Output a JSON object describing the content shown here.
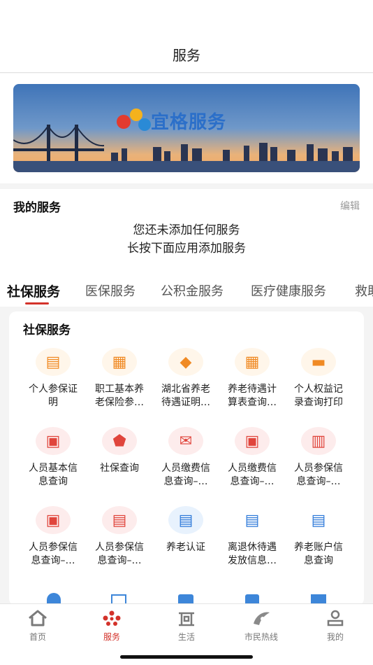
{
  "header": {
    "title": "服务"
  },
  "banner": {
    "logo_text": "宜格服务"
  },
  "my_services": {
    "title": "我的服务",
    "edit_label": "编辑",
    "empty_line1": "您还未添加任何服务",
    "empty_line2": "长按下面应用添加服务"
  },
  "tabs": [
    {
      "label": "社保服务",
      "active": true
    },
    {
      "label": "医保服务",
      "active": false
    },
    {
      "label": "公积金服务",
      "active": false
    },
    {
      "label": "医疗健康服务",
      "active": false
    },
    {
      "label": "救助",
      "active": false
    }
  ],
  "panel": {
    "title": "社保服务"
  },
  "services": [
    {
      "line1": "个人参保证",
      "line2": "明",
      "icon": "certificate-icon",
      "color": "#f08a24",
      "bg": "#fff6ea"
    },
    {
      "line1": "职工基本养",
      "line2": "老保险参…",
      "icon": "pension-form-icon",
      "color": "#f08a24",
      "bg": "#fff6ea"
    },
    {
      "line1": "湖北省养老",
      "line2": "待遇证明…",
      "icon": "hubei-map-icon",
      "color": "#f08a24",
      "bg": "#fff6ea"
    },
    {
      "line1": "养老待遇计",
      "line2": "算表查询…",
      "icon": "calculator-icon",
      "color": "#f08a24",
      "bg": "#fff6ea"
    },
    {
      "line1": "个人权益记",
      "line2": "录查询打印",
      "icon": "printer-icon",
      "color": "#f08a24",
      "bg": "#fff6ea"
    },
    {
      "line1": "人员基本信",
      "line2": "息查询",
      "icon": "person-card-icon",
      "color": "#e0453c",
      "bg": "#fdecec"
    },
    {
      "line1": "社保查询",
      "line2": "",
      "icon": "shield-search-icon",
      "color": "#e0453c",
      "bg": "#fdecec"
    },
    {
      "line1": "人员缴费信",
      "line2": "息查询–…",
      "icon": "payment-mail-icon",
      "color": "#e0453c",
      "bg": "#fdecec"
    },
    {
      "line1": "人员缴费信",
      "line2": "息查询–…",
      "icon": "payment-person-icon",
      "color": "#e0453c",
      "bg": "#fdecec"
    },
    {
      "line1": "人员参保信",
      "line2": "息查询–…",
      "icon": "insured-group-icon",
      "color": "#e0453c",
      "bg": "#fdecec"
    },
    {
      "line1": "人员参保信",
      "line2": "息查询–…",
      "icon": "id-check-icon",
      "color": "#e0453c",
      "bg": "#fdecec"
    },
    {
      "line1": "人员参保信",
      "line2": "息查询–…",
      "icon": "id-card-icon",
      "color": "#e0453c",
      "bg": "#fdecec"
    },
    {
      "line1": "养老认证",
      "line2": "",
      "icon": "auth-doc-icon",
      "color": "#2f7ad9",
      "bg": "#e8f2fd"
    },
    {
      "line1": "离退休待遇",
      "line2": "发放信息…",
      "icon": "retire-pay-icon",
      "color": "#2f7ad9",
      "bg": "#ffffff"
    },
    {
      "line1": "养老账户信",
      "line2": "息查询",
      "icon": "account-search-icon",
      "color": "#2f7ad9",
      "bg": "#ffffff"
    }
  ],
  "tabbar": [
    {
      "label": "首页",
      "icon": "home-icon",
      "active": false
    },
    {
      "label": "服务",
      "icon": "service-icon",
      "active": true
    },
    {
      "label": "生活",
      "icon": "life-icon",
      "active": false
    },
    {
      "label": "市民热线",
      "icon": "hotline-icon",
      "active": false
    },
    {
      "label": "我的",
      "icon": "profile-icon",
      "active": false
    }
  ],
  "colors": {
    "accent": "#d3322a",
    "orange": "#f08a24",
    "red": "#e0453c",
    "blue": "#2f7ad9"
  }
}
